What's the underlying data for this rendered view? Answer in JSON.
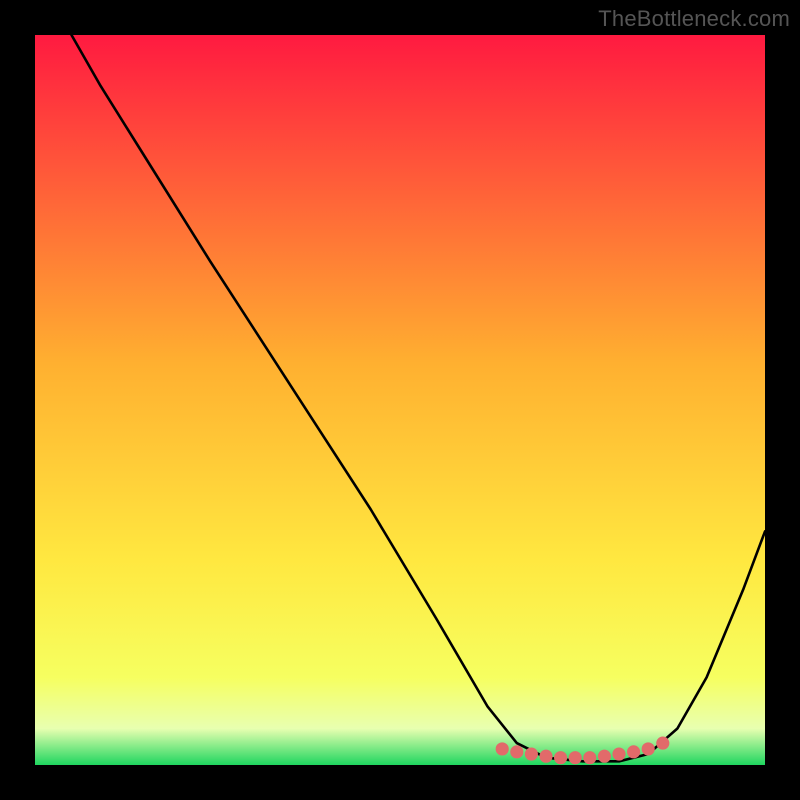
{
  "watermark": "TheBottleneck.com",
  "colors": {
    "frame": "#000000",
    "curve": "#000000",
    "dots": "#e26a6a",
    "gradient_top": "#ff1a40",
    "gradient_upper_mid": "#ffb030",
    "gradient_mid": "#ffe840",
    "gradient_lower_mid": "#f6ff60",
    "gradient_ribbon": "#e8ffb0",
    "gradient_bottom": "#1fd65f"
  },
  "chart_data": {
    "type": "line",
    "title": "",
    "xlabel": "",
    "ylabel": "",
    "xlim": [
      0,
      100
    ],
    "ylim": [
      0,
      100
    ],
    "curve_points": [
      {
        "x": 5,
        "y": 100
      },
      {
        "x": 9,
        "y": 93
      },
      {
        "x": 14,
        "y": 85
      },
      {
        "x": 24,
        "y": 69
      },
      {
        "x": 35,
        "y": 52
      },
      {
        "x": 46,
        "y": 35
      },
      {
        "x": 55,
        "y": 20
      },
      {
        "x": 62,
        "y": 8
      },
      {
        "x": 66,
        "y": 3
      },
      {
        "x": 70,
        "y": 1
      },
      {
        "x": 75,
        "y": 0.5
      },
      {
        "x": 80,
        "y": 0.5
      },
      {
        "x": 84,
        "y": 1.5
      },
      {
        "x": 88,
        "y": 5
      },
      {
        "x": 92,
        "y": 12
      },
      {
        "x": 97,
        "y": 24
      },
      {
        "x": 100,
        "y": 32
      }
    ],
    "bottom_dots": [
      {
        "x": 64,
        "y": 2.2
      },
      {
        "x": 66,
        "y": 1.8
      },
      {
        "x": 68,
        "y": 1.5
      },
      {
        "x": 70,
        "y": 1.2
      },
      {
        "x": 72,
        "y": 1.0
      },
      {
        "x": 74,
        "y": 1.0
      },
      {
        "x": 76,
        "y": 1.0
      },
      {
        "x": 78,
        "y": 1.2
      },
      {
        "x": 80,
        "y": 1.5
      },
      {
        "x": 82,
        "y": 1.8
      },
      {
        "x": 84,
        "y": 2.2
      },
      {
        "x": 86,
        "y": 3.0
      }
    ],
    "gradient_stops": [
      {
        "offset": 0,
        "color_key": "gradient_top"
      },
      {
        "offset": 0.45,
        "color_key": "gradient_upper_mid"
      },
      {
        "offset": 0.72,
        "color_key": "gradient_mid"
      },
      {
        "offset": 0.88,
        "color_key": "gradient_lower_mid"
      },
      {
        "offset": 0.95,
        "color_key": "gradient_ribbon"
      },
      {
        "offset": 1.0,
        "color_key": "gradient_bottom"
      }
    ]
  }
}
